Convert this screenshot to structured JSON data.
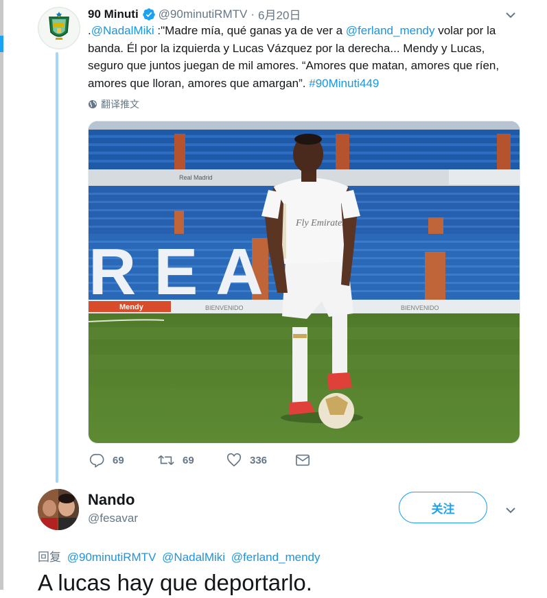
{
  "tweet": {
    "author_name": "90 Minuti",
    "author_handle": "@90minutiRMTV",
    "separator": "·",
    "date": "6月20日",
    "text_parts": {
      "p1": ".",
      "mention1": "@NadalMiki",
      "p2": " :\"Madre mía, qué ganas ya de ver a ",
      "mention2": "@ferland_mendy",
      "p3": " volar por la banda. Él por la izquierda y Lucas Vázquez por la derecha... Mendy y Lucas, seguro que juntos juegan de mil amores. “Amores que matan, amores que ríen, amores que lloran, amores que amargan”. ",
      "hashtag": "#90Minuti449"
    },
    "translate_label": "翻译推文",
    "photo": {
      "sponsor_text": "Fly Emirates",
      "stand_letters": "REAL",
      "board_text": "BIENVENIDO",
      "ad_text": "Mendy",
      "stand_sign": "Real Madrid"
    },
    "actions": {
      "reply_count": "69",
      "retweet_count": "69",
      "like_count": "336"
    },
    "icons": [
      "verified-badge-icon",
      "chevron-down-icon",
      "globe-icon",
      "reply-icon",
      "retweet-icon",
      "like-icon",
      "message-icon"
    ]
  },
  "reply": {
    "author_name": "Nando",
    "author_handle": "@fesavar",
    "follow_label": "关注",
    "reply_to_prefix": "回复",
    "reply_to_mentions": [
      "@90minutiRMTV",
      "@NadalMiki",
      "@ferland_mendy"
    ],
    "text": "A lucas hay que deportarlo."
  },
  "colors": {
    "accent": "#1da1f2",
    "link": "#1b95e0",
    "muted": "#657786",
    "text": "#14171a",
    "thread_line": "#a6d6f7"
  }
}
